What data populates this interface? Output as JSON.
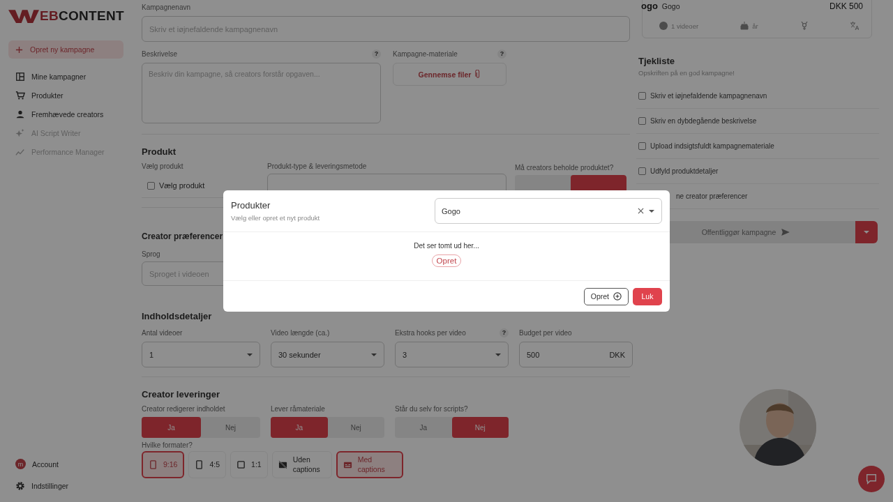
{
  "logo": {
    "accent": "EB",
    "rest": "CONTENT"
  },
  "sidebar": {
    "create_button": "Opret ny kampagne",
    "items": [
      {
        "label": "Mine kampagner",
        "kind": "layout",
        "disabled": false
      },
      {
        "label": "Produkter",
        "kind": "cart",
        "disabled": false
      },
      {
        "label": "Fremhævede creators",
        "kind": "person",
        "disabled": false
      },
      {
        "label": "AI Script Writer",
        "kind": "sparkle",
        "disabled": true
      },
      {
        "label": "Performance Manager",
        "kind": "trend",
        "disabled": true
      }
    ],
    "account": {
      "avatar": "m",
      "label": "Account"
    },
    "settings": "Indstillinger"
  },
  "form": {
    "campaign_name": {
      "label": "Kampagnenavn",
      "placeholder": "Skriv et iøjnefaldende kampagnenavn"
    },
    "description": {
      "label": "Beskrivelse",
      "help": "?",
      "placeholder": "Beskriv din kampagne, så creators forstår opgaven..."
    },
    "material": {
      "label": "Kampagne-materiale",
      "help": "?",
      "button": "Gennemse filer"
    },
    "product": {
      "heading": "Produkt",
      "choose_label": "Vælg produkt",
      "choose_option": "Vælg produkt",
      "choose_checked": false,
      "type_label": "Produkt-type & leveringsmetode",
      "keep_label": "Må creators beholde produktet?",
      "keep_options": [
        {
          "selected": false
        },
        {
          "selected": true
        }
      ]
    },
    "preferences": {
      "heading": "Creator præferencer",
      "language_label": "Sprog",
      "language_placeholder": "Sproget i videoen"
    },
    "content": {
      "heading": "Indholdsdetaljer",
      "fields": [
        {
          "label": "Antal videoer",
          "value": "1",
          "kind": "select"
        },
        {
          "label": "Video længde (ca.)",
          "value": "30 sekunder",
          "kind": "select"
        },
        {
          "label": "Ekstra hooks per video",
          "help": "?",
          "value": "3",
          "kind": "select"
        },
        {
          "label": "Budget per video",
          "value": "500",
          "suffix": "DKK",
          "kind": "currency"
        }
      ]
    },
    "deliveries": {
      "heading": "Creator leveringer",
      "toggles": [
        {
          "label": "Creator redigerer indholdet",
          "options": [
            {
              "label": "Ja",
              "selected": true
            },
            {
              "label": "Nej",
              "selected": false
            }
          ]
        },
        {
          "label": "Lever råmateriale",
          "options": [
            {
              "label": "Ja",
              "selected": true
            },
            {
              "label": "Nej",
              "selected": false
            }
          ]
        },
        {
          "label": "Står du selv for scripts?",
          "options": [
            {
              "label": "Ja",
              "selected": false
            },
            {
              "label": "Nej",
              "selected": true
            }
          ]
        }
      ],
      "formats_label": "Hvilke formater?",
      "formats": [
        {
          "label": "9:16",
          "kind": "portrait",
          "selected": true
        },
        {
          "label": "4:5",
          "kind": "portrait",
          "selected": false
        },
        {
          "label": "1:1",
          "kind": "square",
          "selected": false
        },
        {
          "label": "Uden captions",
          "kind": "nocaptions",
          "selected": false
        },
        {
          "label": "Med captions",
          "kind": "captions",
          "selected": true
        }
      ]
    }
  },
  "summary": {
    "logo": "ogo",
    "name": "Gogo",
    "price": "DKK 500",
    "videos": "1 videoer",
    "age": "år"
  },
  "checklist": {
    "title": "Tjekliste",
    "subtitle": "Opskriften på en god kampagne!",
    "items": [
      {
        "label": "Skriv et iøjnefaldende kampagnenavn",
        "checked": false
      },
      {
        "label": "Skriv en dybdegående beskrivelse",
        "checked": false
      },
      {
        "label": "Upload indsigtsfuldt kampagnemateriale",
        "checked": false
      },
      {
        "label": "Udfyld produktdetaljer",
        "checked": false
      },
      {
        "label": "ne creator præferencer"
      }
    ]
  },
  "publish": {
    "label": "Offentliggør kampagne",
    "disabled": true
  },
  "modal": {
    "title": "Produkter",
    "subtitle": "Vælg eller opret et nyt produkt",
    "search_value": "Gogo",
    "empty_text": "Det ser tomt ud her...",
    "create_link": "Opret",
    "create_button": "Opret",
    "close_button": "Luk"
  }
}
